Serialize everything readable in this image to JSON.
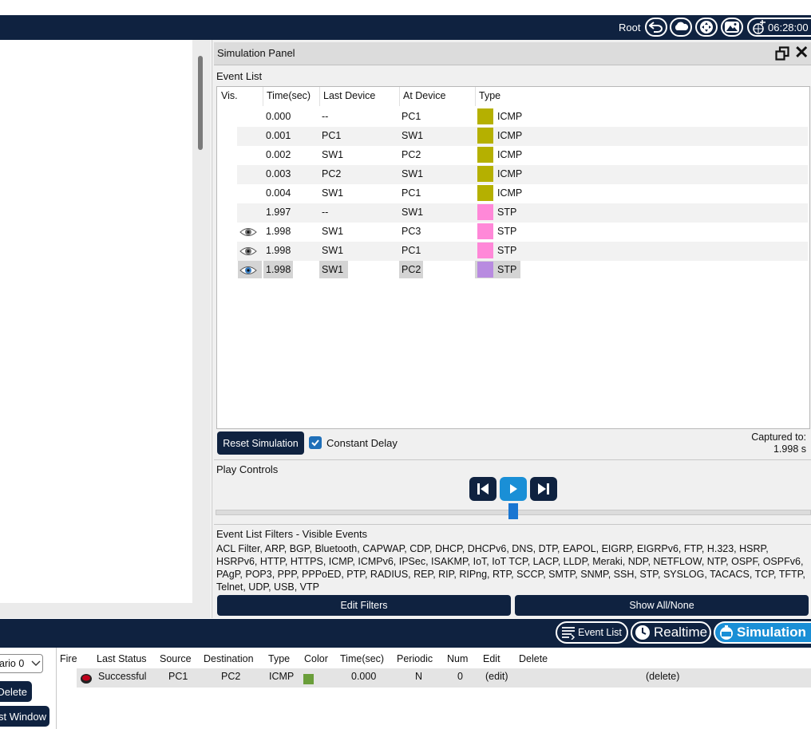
{
  "topbar": {
    "user": "Root",
    "time": "06:28:00"
  },
  "sim_panel": {
    "title": "Simulation Panel",
    "event_list_label": "Event List",
    "columns": [
      "Vis.",
      "Time(sec)",
      "Last Device",
      "At Device",
      "Type"
    ],
    "events": [
      {
        "time": "0.000",
        "last": "--",
        "at": "PC1",
        "type": "ICMP",
        "color": "#b5b000",
        "eye": "none"
      },
      {
        "time": "0.001",
        "last": "PC1",
        "at": "SW1",
        "type": "ICMP",
        "color": "#b5b000",
        "eye": "none"
      },
      {
        "time": "0.002",
        "last": "SW1",
        "at": "PC2",
        "type": "ICMP",
        "color": "#b5b000",
        "eye": "none"
      },
      {
        "time": "0.003",
        "last": "PC2",
        "at": "SW1",
        "type": "ICMP",
        "color": "#b5b000",
        "eye": "none"
      },
      {
        "time": "0.004",
        "last": "SW1",
        "at": "PC1",
        "type": "ICMP",
        "color": "#b5b000",
        "eye": "none"
      },
      {
        "time": "1.997",
        "last": "--",
        "at": "SW1",
        "type": "STP",
        "color": "#ff88d8",
        "eye": "none"
      },
      {
        "time": "1.998",
        "last": "SW1",
        "at": "PC3",
        "type": "STP",
        "color": "#ff88d8",
        "eye": "grey"
      },
      {
        "time": "1.998",
        "last": "SW1",
        "at": "PC1",
        "type": "STP",
        "color": "#ff88d8",
        "eye": "grey"
      },
      {
        "time": "1.998",
        "last": "SW1",
        "at": "PC2",
        "type": "STP",
        "color": "#b88be0",
        "eye": "blue"
      }
    ],
    "reset_label": "Reset Simulation",
    "constant_delay_label": "Constant Delay",
    "captured_label": "Captured to:",
    "captured_value": "1.998 s",
    "play_controls_label": "Play Controls",
    "filters_title": "Event List Filters - Visible Events",
    "filters_text": "ACL Filter, ARP, BGP, Bluetooth, CAPWAP, CDP, DHCP, DHCPv6, DNS, DTP, EAPOL, EIGRP, EIGRPv6, FTP, H.323, HSRP, HSRPv6, HTTP, HTTPS, ICMP, ICMPv6, IPSec, ISAKMP, IoT, IoT TCP, LACP, LLDP, Meraki, NDP, NETFLOW, NTP, OSPF, OSPFv6, PAgP, POP3, PPP, PPPoED, PTP, RADIUS, REP, RIP, RIPng, RTP, SCCP, SMTP, SNMP, SSH, STP, SYSLOG, TACACS, TCP, TFTP, Telnet, UDP, USB, VTP",
    "edit_filters_label": "Edit Filters",
    "show_all_label": "Show All/None"
  },
  "bottombar": {
    "event_list": "Event List",
    "realtime": "Realtime",
    "simulation": "Simulation"
  },
  "pdu_panel": {
    "scenario": "ario 0",
    "delete_label": "Delete",
    "list_window_label": "st Window",
    "columns": [
      "Fire",
      "Last Status",
      "Source",
      "Destination",
      "Type",
      "Color",
      "Time(sec)",
      "Periodic",
      "Num",
      "Edit",
      "Delete"
    ],
    "rows": [
      {
        "status": "Successful",
        "source": "PC1",
        "destination": "PC2",
        "type": "ICMP",
        "color": "#6a9e3a",
        "time": "0.000",
        "periodic": "N",
        "num": "0",
        "edit": "(edit)",
        "delete": "(delete)"
      }
    ]
  }
}
